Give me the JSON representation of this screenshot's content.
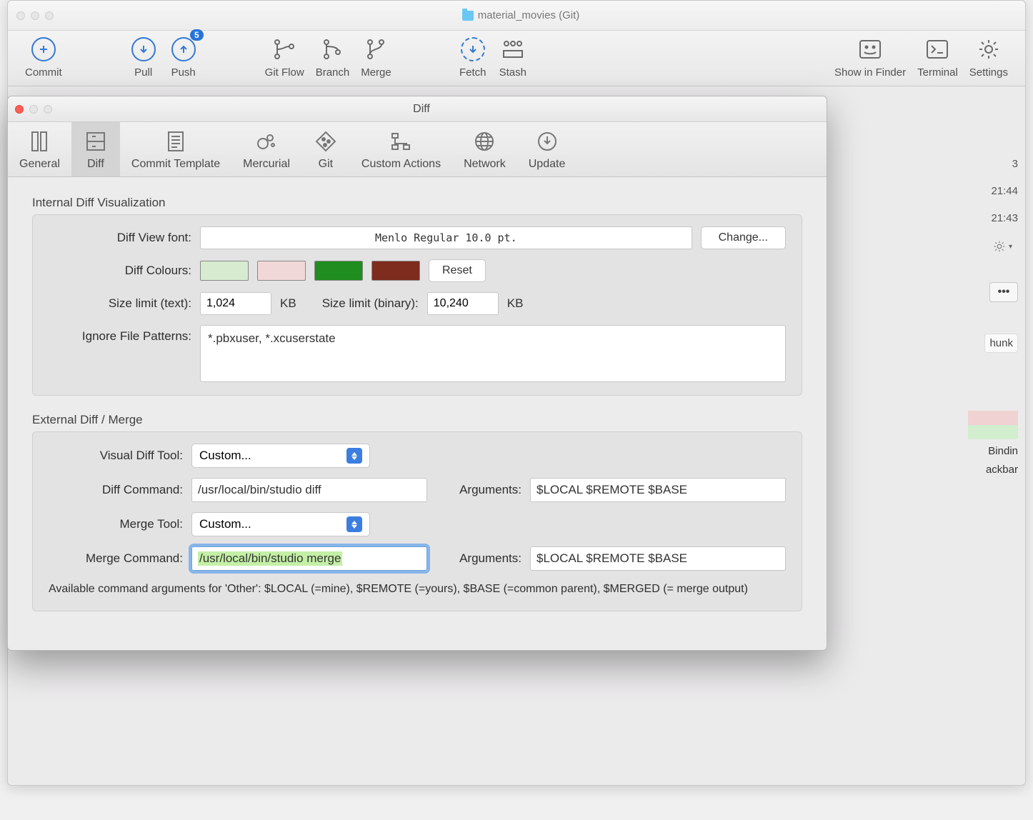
{
  "main": {
    "title": "material_movies (Git)",
    "toolbar": {
      "commit": "Commit",
      "pull": "Pull",
      "push": "Push",
      "push_badge": "5",
      "gitflow": "Git Flow",
      "branch": "Branch",
      "merge": "Merge",
      "fetch": "Fetch",
      "stash": "Stash",
      "finder": "Show in Finder",
      "terminal": "Terminal",
      "settings": "Settings"
    },
    "bg": {
      "row1": "3",
      "row2": "21:44",
      "row3": "21:43",
      "hunk": "hunk",
      "t1": "Bindin",
      "t2": "ackbar",
      "dots": "•••"
    }
  },
  "prefs": {
    "title": "Diff",
    "tabs": {
      "general": "General",
      "diff": "Diff",
      "commit_template": "Commit Template",
      "mercurial": "Mercurial",
      "git": "Git",
      "custom_actions": "Custom Actions",
      "network": "Network",
      "update": "Update"
    },
    "section1": {
      "heading": "Internal Diff Visualization",
      "font_label": "Diff View font:",
      "font_value": "Menlo Regular 10.0 pt.",
      "change": "Change...",
      "colours_label": "Diff Colours:",
      "reset": "Reset",
      "size_text_label": "Size limit (text):",
      "size_text_value": "1,024",
      "kb": "KB",
      "size_bin_label": "Size limit (binary):",
      "size_bin_value": "10,240",
      "ignore_label": "Ignore File Patterns:",
      "ignore_value": "*.pbxuser, *.xcuserstate",
      "colors": {
        "c1": "#d7ebd0",
        "c2": "#f1d8d8",
        "c3": "#1f8d1f",
        "c4": "#7d2c1e"
      }
    },
    "section2": {
      "heading": "External Diff / Merge",
      "visual_label": "Visual Diff Tool:",
      "visual_value": "Custom...",
      "diffcmd_label": "Diff Command:",
      "diffcmd_value": "/usr/local/bin/studio diff",
      "args_label": "Arguments:",
      "diff_args": "$LOCAL $REMOTE $BASE",
      "mergetool_label": "Merge Tool:",
      "mergetool_value": "Custom...",
      "mergecmd_label": "Merge Command:",
      "mergecmd_value": "/usr/local/bin/studio merge",
      "merge_args": "$LOCAL $REMOTE $BASE",
      "help": "Available command arguments for 'Other': $LOCAL (=mine), $REMOTE (=yours), $BASE (=common parent), $MERGED (= merge output)"
    }
  }
}
